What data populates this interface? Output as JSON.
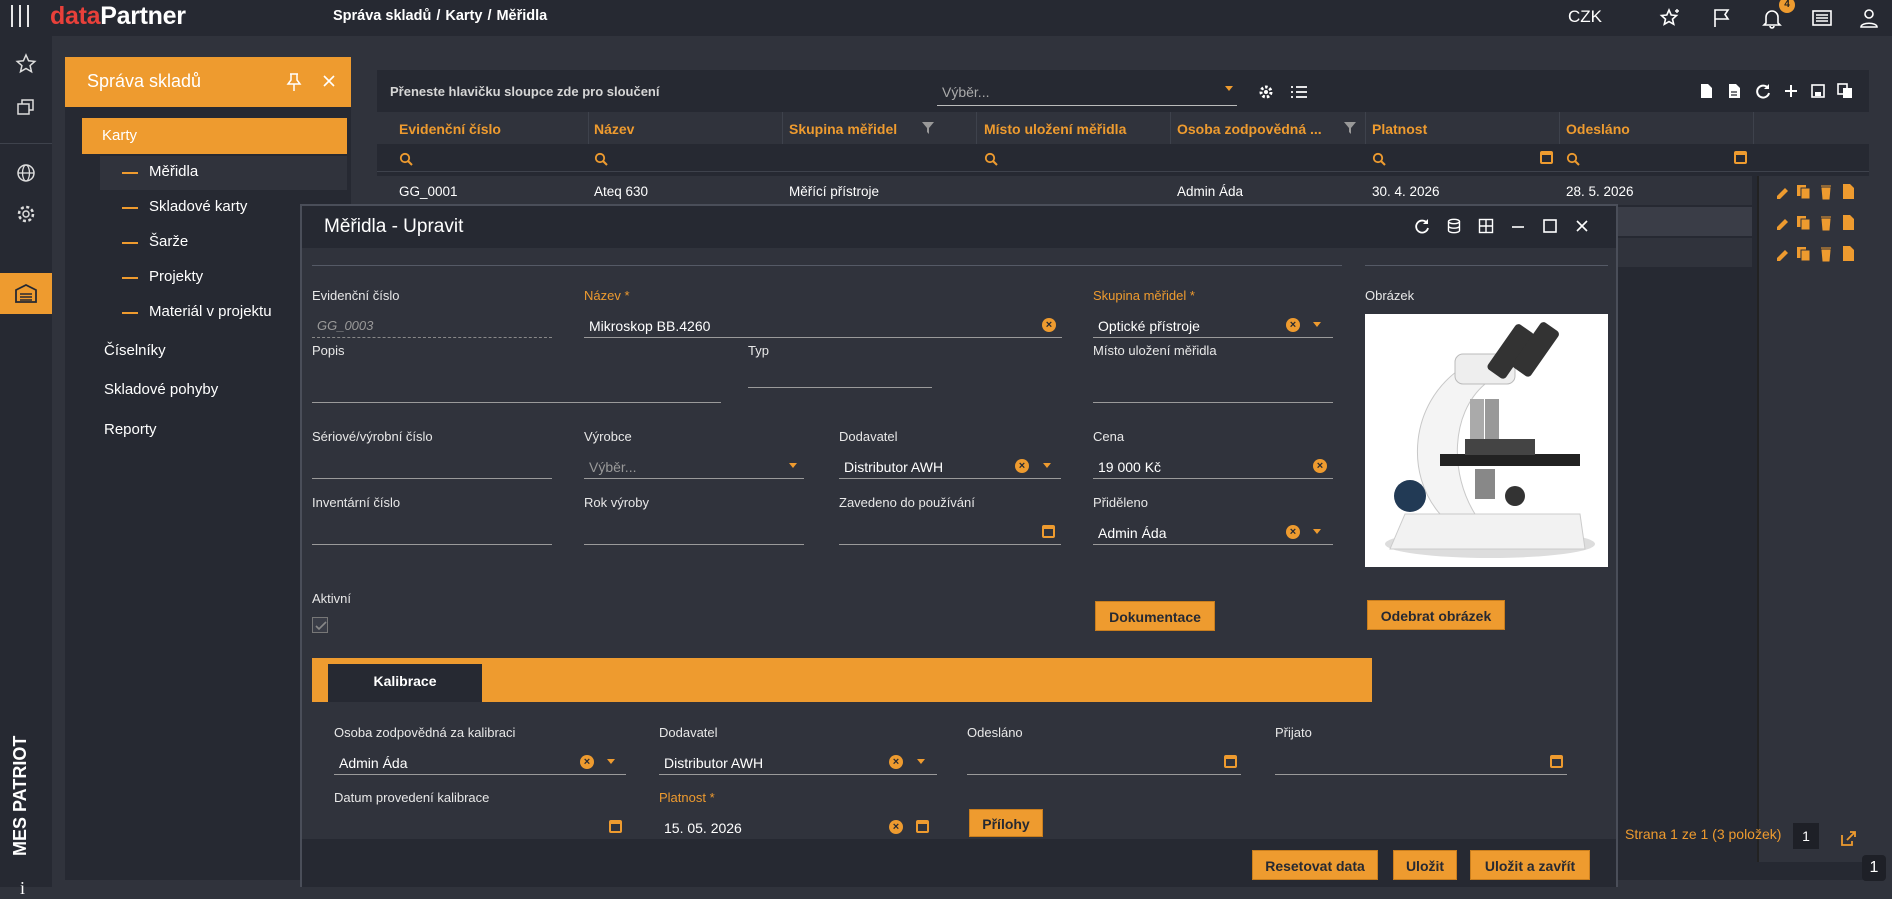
{
  "app": {
    "logo_a": "data",
    "logo_b": "Partner",
    "breadcrumbs": [
      "Správa skladů",
      "Karty",
      "Měřidla"
    ],
    "breadcrumb_sep": "/",
    "currency": "CZK",
    "notifications_count": "4",
    "bottom_badge": "1",
    "vertical_brand": "MES PATRIOT",
    "info_glyph": "i"
  },
  "sidebar": {
    "title": "Správa skladů",
    "items": [
      {
        "label": "Karty",
        "active": true
      },
      {
        "label": "Měřidla",
        "sub": true
      },
      {
        "label": "Skladové karty",
        "sub": true
      },
      {
        "label": "Šarže",
        "sub": true
      },
      {
        "label": "Projekty",
        "sub": true
      },
      {
        "label": "Materiál v projektu",
        "sub": true
      },
      {
        "label": "Číselníky"
      },
      {
        "label": "Skladové pohyby"
      },
      {
        "label": "Reporty"
      }
    ]
  },
  "grid": {
    "group_hint": "Přeneste hlavičku sloupce zde pro sloučení",
    "select_placeholder": "Výběr...",
    "columns": [
      "Evidenční číslo",
      "Název",
      "Skupina měřidel",
      "Místo uložení měřidla",
      "Osoba zodpovědná ...",
      "Platnost",
      "Odesláno"
    ],
    "rows": [
      [
        "GG_0001",
        "Ateq 630",
        "Měřící přístroje",
        "",
        "Admin Áda",
        "30. 4. 2026",
        "28. 5. 2026"
      ]
    ],
    "pager": "Strana 1 ze 1 (3 položek)",
    "page": "1"
  },
  "modal": {
    "title": "Měřidla - Upravit",
    "labels": {
      "evid": "Evidenční číslo",
      "nazev": "Název *",
      "skupina": "Skupina měřidel *",
      "obrazek": "Obrázek",
      "popis": "Popis",
      "typ": "Typ",
      "misto": "Místo uložení měřidla",
      "serial": "Sériové/výrobní číslo",
      "vyrobce": "Výrobce",
      "dodavatel": "Dodavatel",
      "cena": "Cena",
      "inventar": "Inventární číslo",
      "rok": "Rok výroby",
      "zavedeno": "Zavedeno do používání",
      "prideleno": "Přiděleno",
      "aktivni": "Aktivní"
    },
    "values": {
      "evid": "GG_0003",
      "nazev": "Mikroskop BB.4260",
      "skupina": "Optické přístroje",
      "vyrobce_placeholder": "Výběr...",
      "dodavatel": "Distributor AWH",
      "cena": "19 000 Kč",
      "prideleno": "Admin Áda"
    },
    "buttons": {
      "dokumentace": "Dokumentace",
      "odebrat": "Odebrat obrázek",
      "prilohy": "Přílohy",
      "reset": "Resetovat data",
      "ulozit": "Uložit",
      "ulozit_zavrit": "Uložit a zavřít"
    },
    "tab": "Kalibrace",
    "kal": {
      "osoba_label": "Osoba zodpovědná za kalibraci",
      "osoba": "Admin Áda",
      "dodavatel_label": "Dodavatel",
      "dodavatel": "Distributor AWH",
      "odeslano_label": "Odesláno",
      "prijato_label": "Přijato",
      "datum_label": "Datum provedení kalibrace",
      "platnost_label": "Platnost *",
      "platnost": "15. 05. 2026"
    }
  },
  "colors": {
    "accent": "#ee9b2f",
    "panel": "#262932",
    "bg": "#30333c",
    "logo_red": "#e8403a"
  }
}
